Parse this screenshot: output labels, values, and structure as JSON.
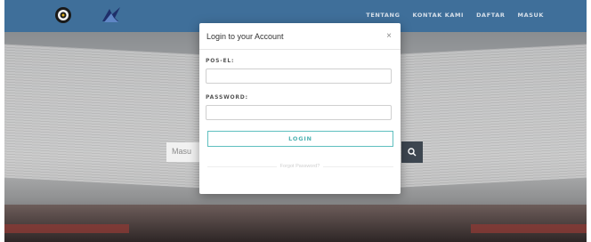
{
  "nav": {
    "logo_icons": [
      "gear-emblem-icon",
      "tut-wuri-handayani-icon"
    ],
    "links": [
      {
        "label": "TENTANG"
      },
      {
        "label": "KONTAK KAMI"
      },
      {
        "label": "DAFTAR"
      },
      {
        "label": "MASUK"
      }
    ]
  },
  "search": {
    "placeholder": "Masu",
    "button_icon": "search-icon"
  },
  "modal": {
    "title": "Login to your Account",
    "close_label": "×",
    "email_label": "POS-EL:",
    "email_value": "",
    "password_label": "PASSWORD:",
    "password_value": "",
    "login_label": "LOGIN",
    "forgot_label": "Forgot Password?"
  },
  "colors": {
    "navbar": "#3f6f9a",
    "accent": "#5fbfbf",
    "search_button": "#3d4650"
  }
}
